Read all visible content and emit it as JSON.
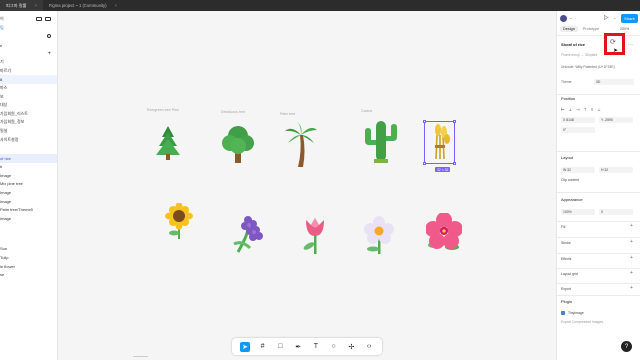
{
  "tabs": [
    {
      "label": "피그마 킬롤",
      "active": true
    },
    {
      "label": "Figma project ~ 1 (Community)",
      "active": false
    }
  ],
  "left_panel": {
    "rows": [
      {
        "text": "이",
        "style": "sect"
      },
      {
        "text": "",
        "style": ""
      },
      {
        "text": "",
        "style": ""
      },
      {
        "text": "",
        "style": ""
      },
      {
        "text": "",
        "style": ""
      },
      {
        "text": "",
        "style": ""
      },
      {
        "text": "기",
        "style": ""
      },
      {
        "text": "",
        "style": ""
      },
      {
        "text": "",
        "style": ""
      },
      {
        "text": "마르기",
        "style": ""
      },
      {
        "text": "8",
        "style": "sel"
      },
      {
        "text": "마스",
        "style": ""
      },
      {
        "text": "보",
        "style": ""
      },
      {
        "text": "대상",
        "style": ""
      },
      {
        "text": "가입회원_리스트",
        "style": ""
      },
      {
        "text": "가입회원_정보",
        "style": ""
      },
      {
        "text": "밀설",
        "style": ""
      },
      {
        "text": "사이트설정",
        "style": ""
      },
      {
        "text": "",
        "style": ""
      },
      {
        "text": "",
        "style": ""
      },
      {
        "text": "of rice",
        "style": "hl"
      },
      {
        "text": "b",
        "style": ""
      },
      {
        "text": "Image",
        "style": ""
      },
      {
        "text": "Mix pine tree",
        "style": ""
      },
      {
        "text": "Image",
        "style": ""
      },
      {
        "text": "Image",
        "style": ""
      },
      {
        "text": "Palm tree/Theme5",
        "style": ""
      },
      {
        "text": "Image",
        "style": ""
      },
      {
        "text": "",
        "style": ""
      },
      {
        "text": "",
        "style": ""
      },
      {
        "text": "",
        "style": ""
      },
      {
        "text": "",
        "style": ""
      },
      {
        "text": "Sun",
        "style": ""
      },
      {
        "text": "",
        "style": ""
      },
      {
        "text": "Tulip",
        "style": ""
      },
      {
        "text": "ie flower",
        "style": ""
      },
      {
        "text": "se",
        "style": ""
      }
    ]
  },
  "canvas": {
    "labels": [
      "Evergreen tree Pine",
      "Deciduous tree",
      "Palm tree",
      "Cactus",
      "Sheaf of rice"
    ],
    "selection_size": "32 × 32"
  },
  "toolbar": {
    "tools": [
      "move-tool",
      "frame-tool",
      "shape-tool",
      "pen-tool",
      "text-tool",
      "comment-tool",
      "actions-tool",
      "dev-mode-tool"
    ]
  },
  "right_panel": {
    "share_label": "Share",
    "tab_design": "Design",
    "tab_prototype": "Prototype",
    "zoom": "200%",
    "layer_name": "Sheaf of rice",
    "breadcrumb": "Fluent emoji → 3D/plant",
    "source": "Unicode: Willy Patented (U+1F33E)",
    "property_label": "Theme",
    "property_value": "3D",
    "position_title": "Position",
    "x": "X  8148",
    "y": "Y  -2590",
    "rotation": "0°",
    "layout_title": "Layout",
    "w": "W  32",
    "h": "H  32",
    "clip_content": "Clip content",
    "appearance_title": "Appearance",
    "opacity": "100%",
    "radius": "0",
    "fill_title": "Fill",
    "stroke_title": "Stroke",
    "effects_title": "Effects",
    "layout_grid_title": "Layout grid",
    "export_title": "Export",
    "plugin_title": "Plugin",
    "plugin_name": "TinyImage",
    "plugin_desc": "Export Compressed Images"
  },
  "colors": {
    "accent": "#0d99ff",
    "selection": "#7b61ff",
    "highlight": "#e0141c"
  }
}
